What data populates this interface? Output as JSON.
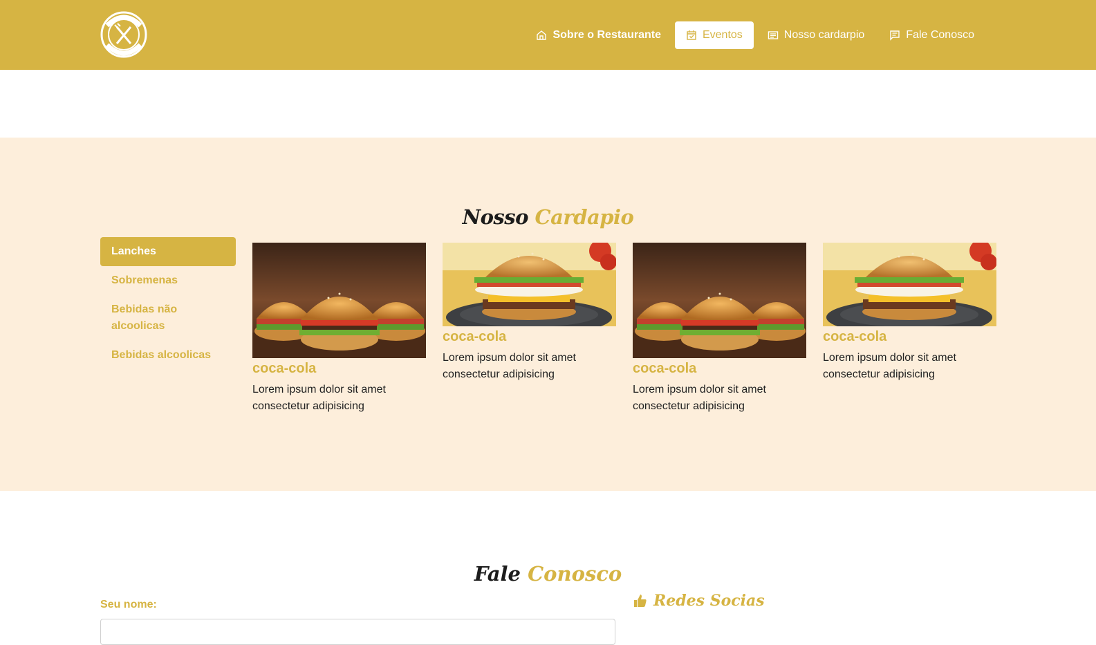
{
  "header": {
    "nav": [
      {
        "label": "Sobre o Restaurante",
        "icon": "home-icon"
      },
      {
        "label": "Eventos",
        "icon": "calendar-icon",
        "active": true
      },
      {
        "label": "Nosso cardarpio",
        "icon": "list-icon"
      },
      {
        "label": "Fale Conosco",
        "icon": "message-icon"
      }
    ]
  },
  "menu": {
    "title_dark": "Nosso",
    "title_gold": "Cardapio",
    "categories": [
      "Lanches",
      "Sobremenas",
      "Bebidas não alcoolicas",
      "Bebidas alcoolicas"
    ],
    "active_category": "Lanches",
    "items": [
      {
        "name": "coca-cola",
        "desc": "Lorem ipsum dolor sit amet consectetur adipisicing"
      },
      {
        "name": "coca-cola",
        "desc": "Lorem ipsum dolor sit amet consectetur adipisicing"
      },
      {
        "name": "coca-cola",
        "desc": "Lorem ipsum dolor sit amet consectetur adipisicing"
      },
      {
        "name": "coca-cola",
        "desc": "Lorem ipsum dolor sit amet consectetur adipisicing"
      }
    ]
  },
  "contact": {
    "title_dark": "Fale",
    "title_gold": "Conosco",
    "name_label": "Seu nome:",
    "social_title": "Redes Socias"
  },
  "colors": {
    "brand": "#d6b443",
    "section_bg": "#fdeedb"
  }
}
